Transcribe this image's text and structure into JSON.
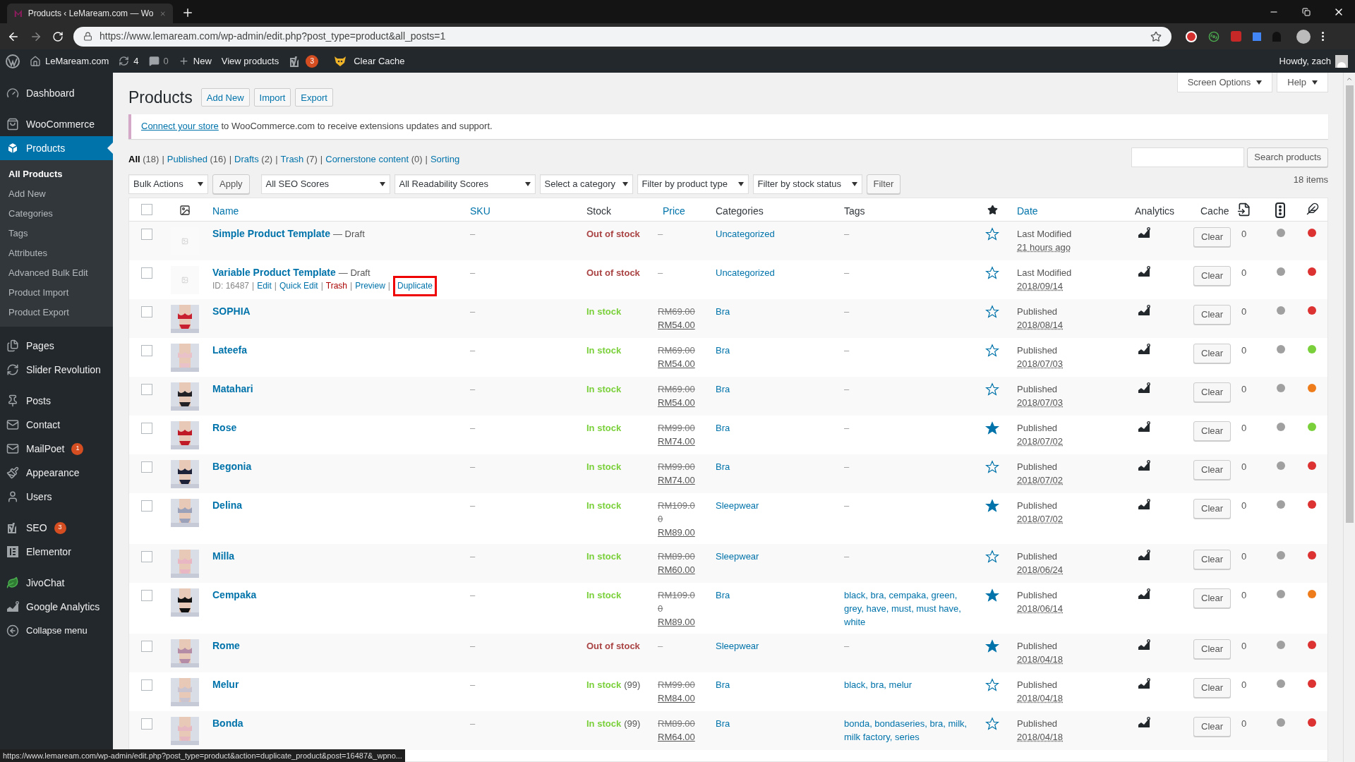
{
  "browser": {
    "tab_title": "Products ‹ LeMaream.com — Wo",
    "url": "https://www.lemaream.com/wp-admin/edit.php?post_type=product&all_posts=1"
  },
  "admin_bar": {
    "site": "LeMaream.com",
    "updates": "4",
    "comments": "0",
    "new": "New",
    "view": "View products",
    "seo_badge": "3",
    "cache": "Clear Cache",
    "greeting": "Howdy, zach"
  },
  "sidebar": {
    "items": [
      {
        "kind": "dashboard",
        "label": "Dashboard",
        "selected": false
      },
      {
        "kind": "woo",
        "label": "WooCommerce",
        "selected": false
      },
      {
        "kind": "products",
        "label": "Products",
        "selected": true
      },
      {
        "kind": "pages",
        "label": "Pages",
        "selected": false
      },
      {
        "kind": "slider",
        "label": "Slider Revolution",
        "selected": false
      },
      {
        "kind": "posts",
        "label": "Posts",
        "selected": false
      },
      {
        "kind": "contact",
        "label": "Contact",
        "selected": false
      },
      {
        "kind": "mailpoet",
        "label": "MailPoet",
        "badge": "1",
        "selected": false
      },
      {
        "kind": "appearance",
        "label": "Appearance",
        "selected": false
      },
      {
        "kind": "users",
        "label": "Users",
        "selected": false
      },
      {
        "kind": "seo",
        "label": "SEO",
        "badge": "3",
        "selected": false
      },
      {
        "kind": "elementor",
        "label": "Elementor",
        "selected": false
      },
      {
        "kind": "jivo",
        "label": "JivoChat",
        "selected": false
      },
      {
        "kind": "analytics",
        "label": "Google Analytics",
        "selected": false
      },
      {
        "kind": "collapse",
        "label": "Collapse menu",
        "selected": false
      }
    ],
    "submenu": [
      {
        "label": "All Products",
        "selected": true
      },
      {
        "label": "Add New",
        "selected": false
      },
      {
        "label": "Categories",
        "selected": false
      },
      {
        "label": "Tags",
        "selected": false
      },
      {
        "label": "Attributes",
        "selected": false
      },
      {
        "label": "Advanced Bulk Edit",
        "selected": false
      },
      {
        "label": "Product Import",
        "selected": false
      },
      {
        "label": "Product Export",
        "selected": false
      }
    ]
  },
  "screen_tabs": [
    "Screen Options",
    "Help"
  ],
  "page": {
    "title": "Products",
    "actions": [
      "Add New",
      "Import",
      "Export"
    ]
  },
  "notice": {
    "link": "Connect your store",
    "text": " to WooCommerce.com to receive extensions updates and support."
  },
  "views": [
    {
      "label": "All",
      "count": "(18)",
      "sep": "|",
      "selected": true
    },
    {
      "label": "Published",
      "count": "(16)",
      "sep": "|",
      "selected": false
    },
    {
      "label": "Drafts",
      "count": "(2)",
      "sep": "|",
      "selected": false
    },
    {
      "label": "Trash",
      "count": "(7)",
      "sep": "|",
      "selected": false
    },
    {
      "label": "Cornerstone content",
      "count": "(0)",
      "sep": "|",
      "selected": false
    },
    {
      "label": "Sorting",
      "selected": false
    }
  ],
  "search": {
    "button": "Search products"
  },
  "filters": {
    "bulk": "Bulk Actions",
    "apply": "Apply",
    "selects": [
      "All SEO Scores",
      "All Readability Scores",
      "Select a category",
      "Filter by product type",
      "Filter by stock status"
    ],
    "filter": "Filter",
    "items": "18 items"
  },
  "columns": [
    {
      "kind": "checkbox",
      "checked": false
    },
    {
      "kind": "thumb-icon"
    },
    {
      "kind": "text",
      "label": "Name",
      "sortable": true
    },
    {
      "kind": "text",
      "label": "SKU",
      "sortable": true
    },
    {
      "kind": "text",
      "label": "Stock",
      "sortable": false
    },
    {
      "kind": "text",
      "label": "Price",
      "sortable": true
    },
    {
      "kind": "text",
      "label": "Categories",
      "sortable": false
    },
    {
      "kind": "text",
      "label": "Tags",
      "sortable": false
    },
    {
      "kind": "star-icon"
    },
    {
      "kind": "text",
      "label": "Date",
      "sortable": true
    },
    {
      "kind": "text",
      "label": "Analytics",
      "sortable": false
    },
    {
      "kind": "text",
      "label": "Cache",
      "sortable": false
    },
    {
      "kind": "links-icon"
    },
    {
      "kind": "seo-icon"
    },
    {
      "kind": "readability-icon"
    }
  ],
  "rows": [
    {
      "checked": false,
      "thumbnail": {
        "kind": "placeholder"
      },
      "name": "Simple Product Template",
      "status": "— Draft",
      "sku": "–",
      "stock": {
        "kind": "out",
        "text": "Out of stock"
      },
      "price_text": "–",
      "categories": "Uncategorized",
      "tags": "–",
      "featured": false,
      "date_status": "Last Modified",
      "date": "21 hours ago",
      "cache": "Clear",
      "links": "0",
      "seo": {
        "color": "#a0a0a0"
      },
      "readability": {
        "color": "#dc3232"
      }
    },
    {
      "checked": false,
      "thumbnail": {
        "kind": "placeholder"
      },
      "name": "Variable Product Template",
      "status": "— Draft",
      "actions": [
        {
          "kind": "text",
          "label": "ID: 16487",
          "sep": "|",
          "highlighted": false
        },
        {
          "kind": "link",
          "label": "Edit",
          "sep": "|",
          "highlighted": false
        },
        {
          "kind": "link",
          "label": "Quick Edit",
          "sep": "|",
          "highlighted": false
        },
        {
          "kind": "trash",
          "label": "Trash",
          "sep": "|",
          "highlighted": false
        },
        {
          "kind": "link",
          "label": "Preview",
          "sep": "|",
          "highlighted": false
        },
        {
          "kind": "link",
          "label": "Duplicate",
          "highlighted": true
        }
      ],
      "sku": "–",
      "stock": {
        "kind": "out",
        "text": "Out of stock"
      },
      "price_text": "–",
      "categories": "Uncategorized",
      "tags": "–",
      "featured": false,
      "date_status": "Last Modified",
      "date": "2018/09/14",
      "cache": "Clear",
      "links": "0",
      "seo": {
        "color": "#a0a0a0"
      },
      "readability": {
        "color": "#dc3232"
      }
    },
    {
      "checked": false,
      "name": "SOPHIA",
      "sku": "–",
      "stock": {
        "kind": "in",
        "text": "In stock"
      },
      "regular": "RM69.00",
      "sale": "RM54.00",
      "categories": "Bra",
      "tags": "–",
      "featured": false,
      "date_status": "Published",
      "date": "2018/08/14",
      "cache": "Clear",
      "links": "0",
      "seo": {
        "color": "#a0a0a0"
      },
      "readability": {
        "color": "#dc3232"
      }
    },
    {
      "checked": false,
      "name": "Lateefa",
      "sku": "–",
      "stock": {
        "kind": "in",
        "text": "In stock"
      },
      "regular": "RM69.00",
      "sale": "RM54.00",
      "categories": "Bra",
      "tags": "–",
      "featured": false,
      "date_status": "Published",
      "date": "2018/07/03",
      "cache": "Clear",
      "links": "0",
      "seo": {
        "color": "#a0a0a0"
      },
      "readability": {
        "color": "#7ad03a"
      }
    },
    {
      "checked": false,
      "name": "Matahari",
      "sku": "–",
      "stock": {
        "kind": "in",
        "text": "In stock"
      },
      "regular": "RM69.00",
      "sale": "RM54.00",
      "categories": "Bra",
      "tags": "–",
      "featured": false,
      "date_status": "Published",
      "date": "2018/07/03",
      "cache": "Clear",
      "links": "0",
      "seo": {
        "color": "#a0a0a0"
      },
      "readability": {
        "color": "#ee7c1b"
      }
    },
    {
      "checked": false,
      "name": "Rose",
      "sku": "–",
      "stock": {
        "kind": "in",
        "text": "In stock"
      },
      "regular": "RM99.00",
      "sale": "RM74.00",
      "categories": "Bra",
      "tags": "–",
      "featured": true,
      "date_status": "Published",
      "date": "2018/07/02",
      "cache": "Clear",
      "links": "0",
      "seo": {
        "color": "#a0a0a0"
      },
      "readability": {
        "color": "#7ad03a"
      }
    },
    {
      "checked": false,
      "name": "Begonia",
      "sku": "–",
      "stock": {
        "kind": "in",
        "text": "In stock"
      },
      "regular": "RM99.00",
      "sale": "RM74.00",
      "categories": "Bra",
      "tags": "–",
      "featured": false,
      "date_status": "Published",
      "date": "2018/07/02",
      "cache": "Clear",
      "links": "0",
      "seo": {
        "color": "#a0a0a0"
      },
      "readability": {
        "color": "#dc3232"
      }
    },
    {
      "checked": false,
      "name": "Delina",
      "sku": "–",
      "stock": {
        "kind": "in",
        "text": "In stock"
      },
      "regular": "RM109.00",
      "sale": "RM89.00",
      "categories": "Sleepwear",
      "tags": "–",
      "featured": true,
      "date_status": "Published",
      "date": "2018/07/02",
      "cache": "Clear",
      "links": "0",
      "seo": {
        "color": "#a0a0a0"
      },
      "readability": {
        "color": "#dc3232"
      }
    },
    {
      "checked": false,
      "name": "Milla",
      "sku": "–",
      "stock": {
        "kind": "in",
        "text": "In stock"
      },
      "regular": "RM89.00",
      "sale": "RM60.00",
      "categories": "Sleepwear",
      "tags": "–",
      "featured": false,
      "date_status": "Published",
      "date": "2018/06/24",
      "cache": "Clear",
      "links": "0",
      "seo": {
        "color": "#a0a0a0"
      },
      "readability": {
        "color": "#dc3232"
      }
    },
    {
      "checked": false,
      "name": "Cempaka",
      "sku": "–",
      "stock": {
        "kind": "in",
        "text": "In stock"
      },
      "regular": "RM109.00",
      "sale": "RM89.00",
      "categories": "Bra",
      "tags": "black, bra, cempaka, green, grey, have, must, must have, white",
      "featured": true,
      "date_status": "Published",
      "date": "2018/06/14",
      "cache": "Clear",
      "links": "0",
      "seo": {
        "color": "#a0a0a0"
      },
      "readability": {
        "color": "#ee7c1b"
      }
    },
    {
      "checked": false,
      "name": "Rome",
      "sku": "–",
      "stock": {
        "kind": "out",
        "text": "Out of stock"
      },
      "price_text": "–",
      "categories": "Sleepwear",
      "tags": "–",
      "featured": true,
      "date_status": "Published",
      "date": "2018/04/18",
      "cache": "Clear",
      "links": "0",
      "seo": {
        "color": "#a0a0a0"
      },
      "readability": {
        "color": "#dc3232"
      }
    },
    {
      "checked": false,
      "name": "Melur",
      "sku": "–",
      "stock": {
        "kind": "in",
        "text": "In stock",
        "count": "(99)"
      },
      "regular": "RM99.00",
      "sale": "RM84.00",
      "categories": "Bra",
      "tags": "black, bra, melur",
      "featured": false,
      "date_status": "Published",
      "date": "2018/04/18",
      "cache": "Clear",
      "links": "0",
      "seo": {
        "color": "#a0a0a0"
      },
      "readability": {
        "color": "#dc3232"
      }
    },
    {
      "checked": false,
      "name": "Bonda",
      "sku": "–",
      "stock": {
        "kind": "in",
        "text": "In stock",
        "count": "(99)"
      },
      "regular": "RM89.00",
      "sale": "RM64.00",
      "categories": "Bra",
      "tags": "bonda, bondaseries, bra, milk, milk factory, series",
      "featured": false,
      "date_status": "Published",
      "date": "2018/04/18",
      "cache": "Clear",
      "links": "0",
      "seo": {
        "color": "#a0a0a0"
      },
      "readability": {
        "color": "#dc3232"
      }
    }
  ],
  "status_url": "https://www.lemaream.com/wp-admin/edit.php?post_type=product&action=duplicate_product&post=16487&_wpno..."
}
